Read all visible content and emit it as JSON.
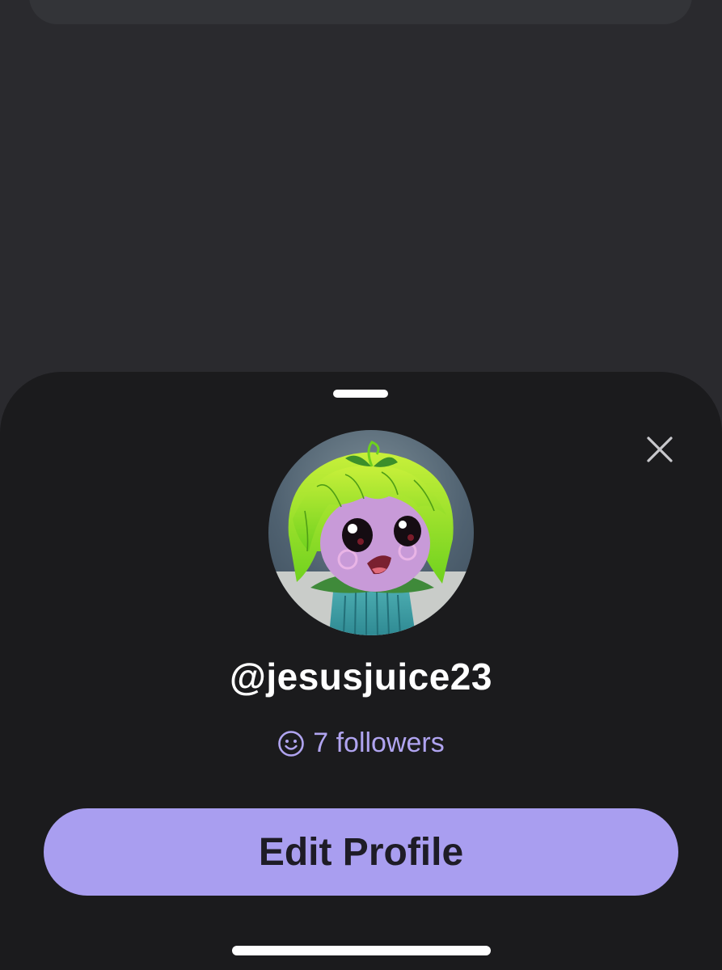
{
  "profile": {
    "username": "@jesusjuice23",
    "followers_label": "7 followers",
    "edit_button_label": "Edit Profile"
  },
  "icons": {
    "close": "close-icon",
    "followers": "smiley-icon",
    "avatar": "avatar-illustration"
  },
  "colors": {
    "background": "#2a2a2e",
    "sheet": "#1b1b1d",
    "accent": "#a99ef0",
    "followers_text": "#b0a4f0",
    "username_text": "#ffffff"
  }
}
